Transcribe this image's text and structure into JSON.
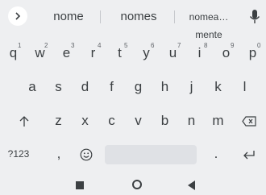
{
  "suggestions": {
    "items": [
      "nome",
      "nomes",
      "nomea…mente"
    ]
  },
  "keyboard": {
    "row1": [
      {
        "label": "q",
        "hint": "1"
      },
      {
        "label": "w",
        "hint": "2"
      },
      {
        "label": "e",
        "hint": "3"
      },
      {
        "label": "r",
        "hint": "4"
      },
      {
        "label": "t",
        "hint": "5"
      },
      {
        "label": "y",
        "hint": "6"
      },
      {
        "label": "u",
        "hint": "7"
      },
      {
        "label": "i",
        "hint": "8"
      },
      {
        "label": "o",
        "hint": "9"
      },
      {
        "label": "p",
        "hint": "0"
      }
    ],
    "row2": [
      "a",
      "s",
      "d",
      "f",
      "g",
      "h",
      "j",
      "k",
      "l"
    ],
    "row3": [
      "z",
      "x",
      "c",
      "v",
      "b",
      "n",
      "m"
    ],
    "symbols_label": "?123",
    "comma_label": ",",
    "period_label": "."
  },
  "icons": {
    "expand": "chevron-right-icon",
    "mic": "mic-icon",
    "shift": "shift-arrow-up-icon",
    "backspace": "backspace-icon",
    "emoji": "emoji-icon",
    "enter": "enter-icon",
    "nav_recents": "square-icon",
    "nav_home": "circle-icon",
    "nav_back": "triangle-back-icon"
  }
}
